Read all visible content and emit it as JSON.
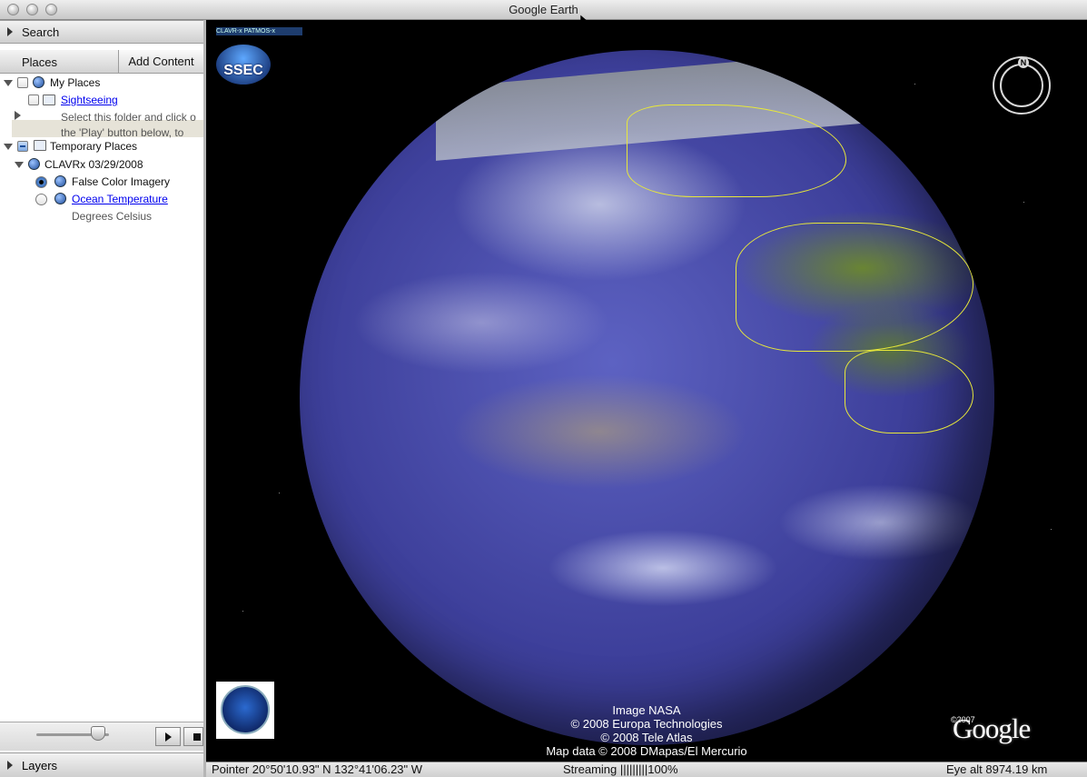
{
  "window": {
    "title": "Google Earth"
  },
  "sidebar": {
    "search_label": "Search",
    "places_label": "Places",
    "add_content_label": "Add Content",
    "layers_label": "Layers",
    "tree": {
      "my_places": "My Places",
      "sightseeing": "Sightseeing",
      "sightseeing_desc_1": "Select this folder and click o",
      "sightseeing_desc_2": "the 'Play' button below, to",
      "temporary_places": "Temporary Places",
      "clavrx": "CLAVRx 03/29/2008",
      "false_color": "False Color Imagery",
      "ocean_temp": "Ocean Temperature",
      "degrees": "Degrees Celsius"
    }
  },
  "map": {
    "clavr_tag": "CLAVR-x PATMOS-x",
    "ssec": "SSEC",
    "compass_n": "N",
    "credits": [
      "Image NASA",
      "© 2008 Europa Technologies",
      "© 2008 Tele Atlas",
      "Map data © 2008 DMapas/El Mercurio"
    ],
    "google_year": "©2007",
    "google_logo": "Google"
  },
  "status": {
    "pointer": "Pointer  20°50'10.93\" N  132°41'06.23\" W",
    "streaming": "Streaming  |||||||||100%",
    "eye_alt": "Eye alt  8974.19 km"
  }
}
